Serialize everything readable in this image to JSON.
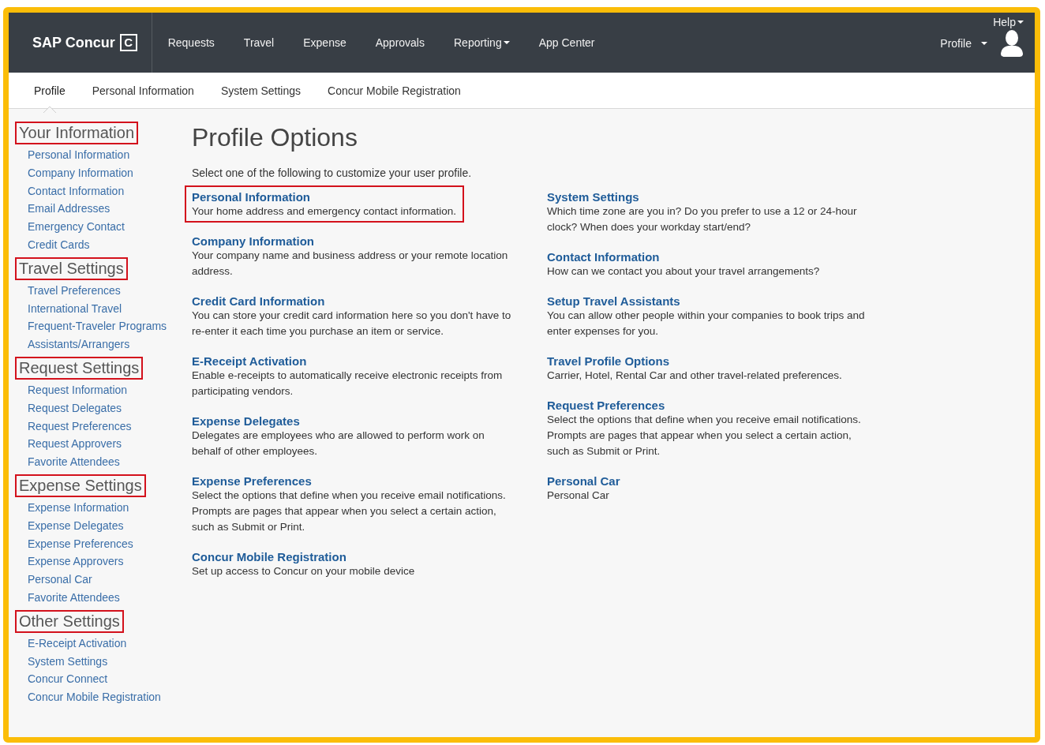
{
  "header": {
    "logo": {
      "text": "SAP Concur",
      "mark": "C"
    },
    "nav": [
      {
        "label": "Requests",
        "menu": false
      },
      {
        "label": "Travel",
        "menu": false
      },
      {
        "label": "Expense",
        "menu": false
      },
      {
        "label": "Approvals",
        "menu": false
      },
      {
        "label": "Reporting",
        "menu": true
      },
      {
        "label": "App Center",
        "menu": false
      }
    ],
    "help": {
      "label": "Help",
      "menu": true
    },
    "profile": {
      "label": "Profile",
      "menu": true
    }
  },
  "subnav": [
    {
      "label": "Profile",
      "selected": true
    },
    {
      "label": "Personal Information",
      "selected": false
    },
    {
      "label": "System Settings",
      "selected": false
    },
    {
      "label": "Concur Mobile Registration",
      "selected": false
    }
  ],
  "sidebar": [
    {
      "title": "Your Information",
      "highlighted": true,
      "items": [
        "Personal Information",
        "Company Information",
        "Contact Information",
        "Email Addresses",
        "Emergency Contact",
        "Credit Cards"
      ]
    },
    {
      "title": "Travel Settings",
      "highlighted": true,
      "items": [
        "Travel Preferences",
        "International Travel",
        "Frequent-Traveler Programs",
        "Assistants/Arrangers"
      ]
    },
    {
      "title": "Request Settings",
      "highlighted": true,
      "items": [
        "Request Information",
        "Request Delegates",
        "Request Preferences",
        "Request Approvers",
        "Favorite Attendees"
      ]
    },
    {
      "title": "Expense Settings",
      "highlighted": true,
      "items": [
        "Expense Information",
        "Expense Delegates",
        "Expense Preferences",
        "Expense Approvers",
        "Personal Car",
        "Favorite Attendees"
      ]
    },
    {
      "title": "Other Settings",
      "highlighted": true,
      "items": [
        "E-Receipt Activation",
        "System Settings",
        "Concur Connect",
        "Concur Mobile Registration"
      ]
    }
  ],
  "main": {
    "title": "Profile Options",
    "intro": "Select one of the following to customize your user profile.",
    "columns": [
      [
        {
          "title": "Personal Information",
          "description": "Your home address and emergency contact information.",
          "highlighted": true
        },
        {
          "title": "Company Information",
          "description": "Your company name and business address or your remote location address.",
          "highlighted": false
        },
        {
          "title": "Credit Card Information",
          "description": "You can store your credit card information here so you don't have to re-enter it each time you purchase an item or service.",
          "highlighted": false
        },
        {
          "title": "E-Receipt Activation",
          "description": "Enable e-receipts to automatically receive electronic receipts from participating vendors.",
          "highlighted": false
        },
        {
          "title": "Expense Delegates",
          "description": "Delegates are employees who are allowed to perform work on behalf of other employees.",
          "highlighted": false
        },
        {
          "title": "Expense Preferences",
          "description": "Select the options that define when you receive email notifications. Prompts are pages that appear when you select a certain action, such as Submit or Print.",
          "highlighted": false
        },
        {
          "title": "Concur Mobile Registration",
          "description": "Set up access to Concur on your mobile device",
          "highlighted": false
        }
      ],
      [
        {
          "title": "System Settings",
          "description": "Which time zone are you in? Do you prefer to use a 12 or 24-hour clock? When does your workday start/end?",
          "highlighted": false
        },
        {
          "title": "Contact Information",
          "description": "How can we contact you about your travel arrangements?",
          "highlighted": false
        },
        {
          "title": "Setup Travel Assistants",
          "description": "You can allow other people within your companies to book trips and enter expenses for you.",
          "highlighted": false
        },
        {
          "title": "Travel Profile Options",
          "description": "Carrier, Hotel, Rental Car and other travel-related preferences.",
          "highlighted": false
        },
        {
          "title": "Request Preferences",
          "description": "Select the options that define when you receive email notifications. Prompts are pages that appear when you select a certain action, such as Submit or Print.",
          "highlighted": false
        },
        {
          "title": "Personal Car",
          "description": "Personal Car",
          "highlighted": false
        }
      ]
    ]
  }
}
